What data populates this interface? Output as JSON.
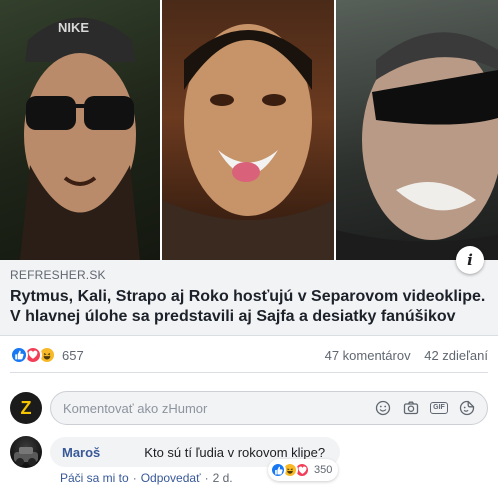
{
  "link_preview": {
    "domain": "REFRESHER.SK",
    "title_line1": "Rytmus, Kali, Strapo aj Roko hosťujú v Separovom videoklipe.",
    "title_line2": "V hlavnej úlohe sa predstavili aj Sajfa a desiatky fanúšikov",
    "cap_lettering": "NIKE"
  },
  "reactions": {
    "icons": [
      "like-icon",
      "love-icon",
      "haha-icon"
    ],
    "count": "657",
    "comments": "47 komentárov",
    "shares": "42 zdieľaní"
  },
  "composer": {
    "placeholder": "Komentovať ako zHumor",
    "avatar_letter": "Z",
    "icons": [
      "emoji-icon",
      "camera-icon",
      "gif-icon",
      "sticker-icon"
    ],
    "gif_label": "GIF"
  },
  "comment": {
    "author": "Maroš",
    "text": "Kto sú tí ľudia v rokovom klipe?",
    "reaction_count": "350",
    "like": "Páči sa mi to",
    "reply": "Odpovedať",
    "time": "2 d."
  },
  "colors": {
    "link_blue": "#385898",
    "like_blue": "#1877f2",
    "love_red": "#f33e58",
    "haha_yellow": "#f7b928",
    "gray_text": "#606770",
    "bg_gray": "#f2f3f5"
  }
}
